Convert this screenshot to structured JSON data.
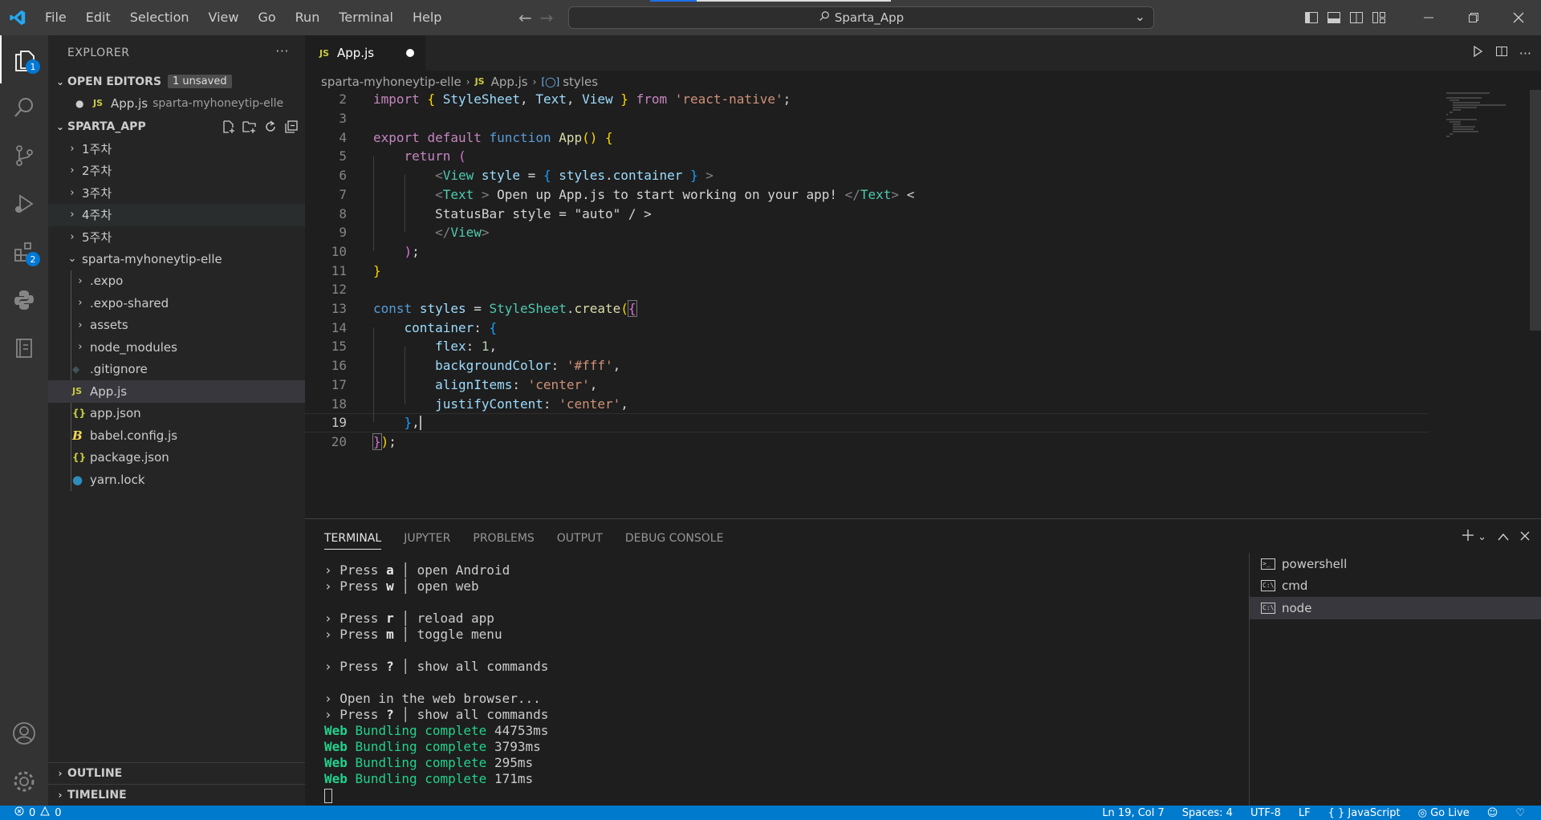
{
  "window": {
    "title": "Sparta_App"
  },
  "menu": [
    "File",
    "Edit",
    "Selection",
    "View",
    "Go",
    "Run",
    "Terminal",
    "Help"
  ],
  "activitybar": {
    "explorer_badge": "1",
    "extensions_badge": "2"
  },
  "sidebar": {
    "header": "EXPLORER",
    "open_editors": {
      "title": "OPEN EDITORS",
      "badge": "1 unsaved",
      "items": [
        {
          "name": "App.js",
          "path": "sparta-myhoneytip-elle"
        }
      ]
    },
    "project": {
      "title": "SPARTA_APP",
      "folders": [
        "1주차",
        "2주차",
        "3주차",
        "4주차",
        "5주차"
      ],
      "subfolder": "sparta-myhoneytip-elle",
      "children": [
        ".expo",
        ".expo-shared",
        "assets",
        "node_modules"
      ],
      "files": [
        ".gitignore",
        "App.js",
        "app.json",
        "babel.config.js",
        "package.json",
        "yarn.lock"
      ]
    },
    "outline": "OUTLINE",
    "timeline": "TIMELINE"
  },
  "editor": {
    "tab": "App.js",
    "breadcrumb": [
      "sparta-myhoneytip-elle",
      "App.js",
      "styles"
    ],
    "line_numbers": [
      "2",
      "3",
      "4",
      "5",
      "6",
      "7",
      "8",
      "9",
      "10",
      "11",
      "12",
      "13",
      "14",
      "15",
      "16",
      "17",
      "18",
      "19",
      "20"
    ]
  },
  "panel": {
    "tabs": [
      "TERMINAL",
      "JUPYTER",
      "PROBLEMS",
      "OUTPUT",
      "DEBUG CONSOLE"
    ],
    "terminals": [
      "powershell",
      "cmd",
      "node"
    ],
    "output": {
      "a_key": "a",
      "a_text": "open Android",
      "w_key": "w",
      "w_text": "open web",
      "r_key": "r",
      "r_text": "reload app",
      "m_key": "m",
      "m_text": "toggle menu",
      "q_key": "?",
      "q_text": "show all commands",
      "open_browser": "Open in the web browser...",
      "bundles": [
        {
          "label": "Web",
          "text": "Bundling complete",
          "time": "44753ms"
        },
        {
          "label": "Web",
          "text": "Bundling complete",
          "time": "3793ms"
        },
        {
          "label": "Web",
          "text": "Bundling complete",
          "time": "295ms"
        },
        {
          "label": "Web",
          "text": "Bundling complete",
          "time": "171ms"
        }
      ]
    }
  },
  "statusbar": {
    "errors": "0",
    "warnings": "0",
    "position": "Ln 19, Col 7",
    "spaces": "Spaces: 4",
    "encoding": "UTF-8",
    "eol": "LF",
    "language": "JavaScript",
    "golive": "Go Live"
  }
}
